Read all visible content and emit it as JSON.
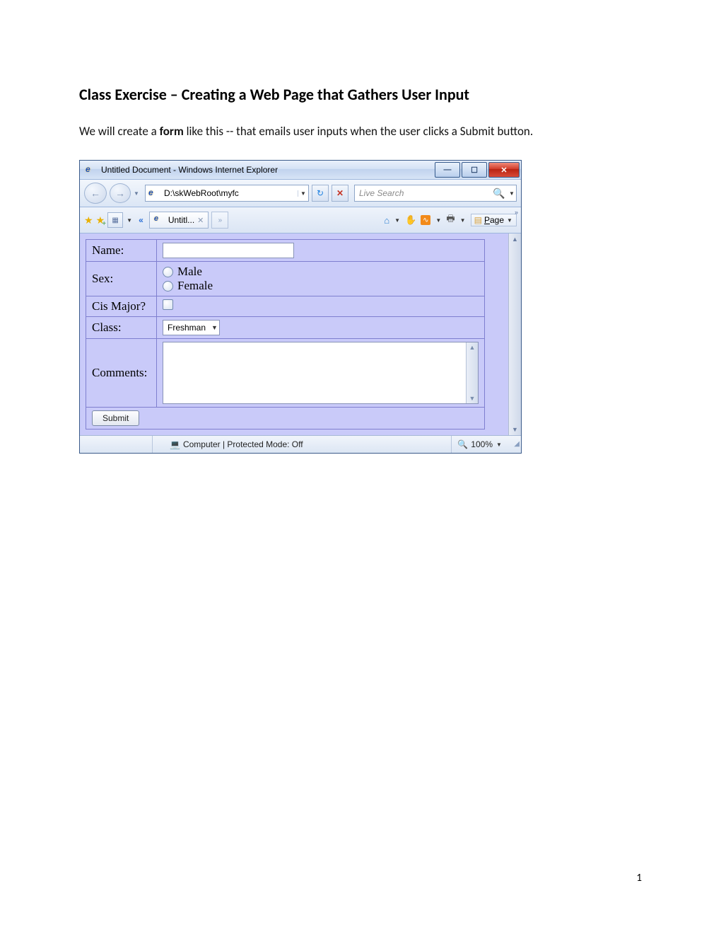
{
  "doc": {
    "heading": "Class Exercise – Creating a Web Page that Gathers User Input",
    "intro_before": "We will create a ",
    "intro_bold": "form",
    "intro_after": " like this -- that emails user inputs when the user clicks a Submit button.",
    "page_number": "1"
  },
  "window": {
    "title": "Untitled Document - Windows Internet Explorer",
    "win_buttons": {
      "minimize": "—",
      "maximize": "☐",
      "close": "✕"
    }
  },
  "navbar": {
    "address": "D:\\skWebRoot\\myfc",
    "search_placeholder": "Live Search"
  },
  "tabs": {
    "active_label": "Untitl...",
    "page_menu_label": "Page"
  },
  "form": {
    "rows": {
      "name": {
        "label": "Name:"
      },
      "sex": {
        "label": "Sex:",
        "options": [
          "Male",
          "Female"
        ]
      },
      "cis": {
        "label": "Cis Major?"
      },
      "class": {
        "label": "Class:",
        "selected": "Freshman"
      },
      "comments": {
        "label": "Comments:"
      },
      "submit": {
        "label": "Submit"
      }
    }
  },
  "statusbar": {
    "zone": "Computer | Protected Mode: Off",
    "zoom": "100%"
  }
}
